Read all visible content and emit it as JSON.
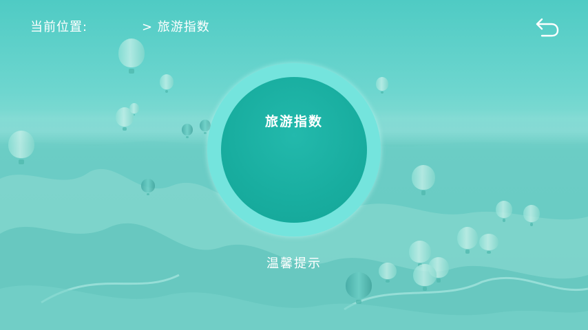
{
  "header": {
    "location_label": "当前位置:",
    "location_path": "> 旅游指数",
    "back_icon": "back-arrow-icon"
  },
  "main": {
    "circle_title": "旅游指数",
    "tips_title": "温馨提示"
  },
  "colors": {
    "ring": "#74e4dd",
    "circle": "#18ad9f",
    "background": "#5cc2b9"
  }
}
